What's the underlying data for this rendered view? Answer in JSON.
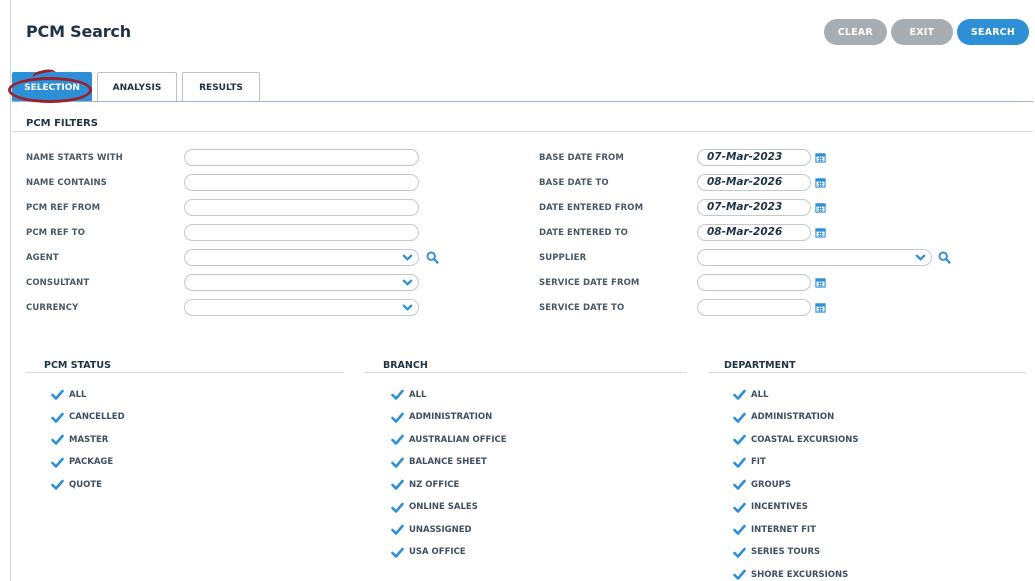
{
  "page": {
    "title": "PCM Search"
  },
  "buttons": {
    "clear": "CLEAR",
    "exit": "EXIT",
    "search": "SEARCH"
  },
  "tabs": [
    {
      "label": "SELECTION",
      "active": true
    },
    {
      "label": "ANALYSIS",
      "active": false
    },
    {
      "label": "RESULTS",
      "active": false
    }
  ],
  "filters": {
    "title": "PCM FILTERS",
    "left": [
      {
        "label": "NAME STARTS WITH",
        "type": "text",
        "value": ""
      },
      {
        "label": "NAME CONTAINS",
        "type": "text",
        "value": ""
      },
      {
        "label": "PCM REF FROM",
        "type": "text",
        "value": ""
      },
      {
        "label": "PCM REF TO",
        "type": "text",
        "value": ""
      },
      {
        "label": "AGENT",
        "type": "select-search",
        "value": ""
      },
      {
        "label": "CONSULTANT",
        "type": "select",
        "value": ""
      },
      {
        "label": "CURRENCY",
        "type": "select",
        "value": ""
      }
    ],
    "right": [
      {
        "label": "BASE DATE FROM",
        "type": "date",
        "value": "07-Mar-2023"
      },
      {
        "label": "BASE DATE TO",
        "type": "date",
        "value": "08-Mar-2026"
      },
      {
        "label": "DATE ENTERED FROM",
        "type": "date",
        "value": "07-Mar-2023"
      },
      {
        "label": "DATE ENTERED TO",
        "type": "date",
        "value": "08-Mar-2026"
      },
      {
        "label": "SUPPLIER",
        "type": "select-search",
        "value": ""
      },
      {
        "label": "SERVICE DATE FROM",
        "type": "date",
        "value": ""
      },
      {
        "label": "SERVICE DATE TO",
        "type": "date",
        "value": ""
      }
    ]
  },
  "groups": [
    {
      "title": "PCM STATUS",
      "items": [
        "ALL",
        "CANCELLED",
        "MASTER",
        "PACKAGE",
        "QUOTE"
      ]
    },
    {
      "title": "BRANCH",
      "items": [
        "ALL",
        "ADMINISTRATION",
        "AUSTRALIAN OFFICE",
        "BALANCE SHEET",
        "NZ OFFICE",
        "ONLINE SALES",
        "UNASSIGNED",
        "USA OFFICE"
      ]
    },
    {
      "title": "DEPARTMENT",
      "items": [
        "ALL",
        "ADMINISTRATION",
        "COASTAL EXCURSIONS",
        "FIT",
        "GROUPS",
        "INCENTIVES",
        "INTERNET FIT",
        "SERIES TOURS",
        "SHORE EXCURSIONS"
      ]
    }
  ],
  "colors": {
    "accent": "#2d8fd6",
    "button_grey": "#a7adb3",
    "annotation": "#9e1f2c"
  }
}
